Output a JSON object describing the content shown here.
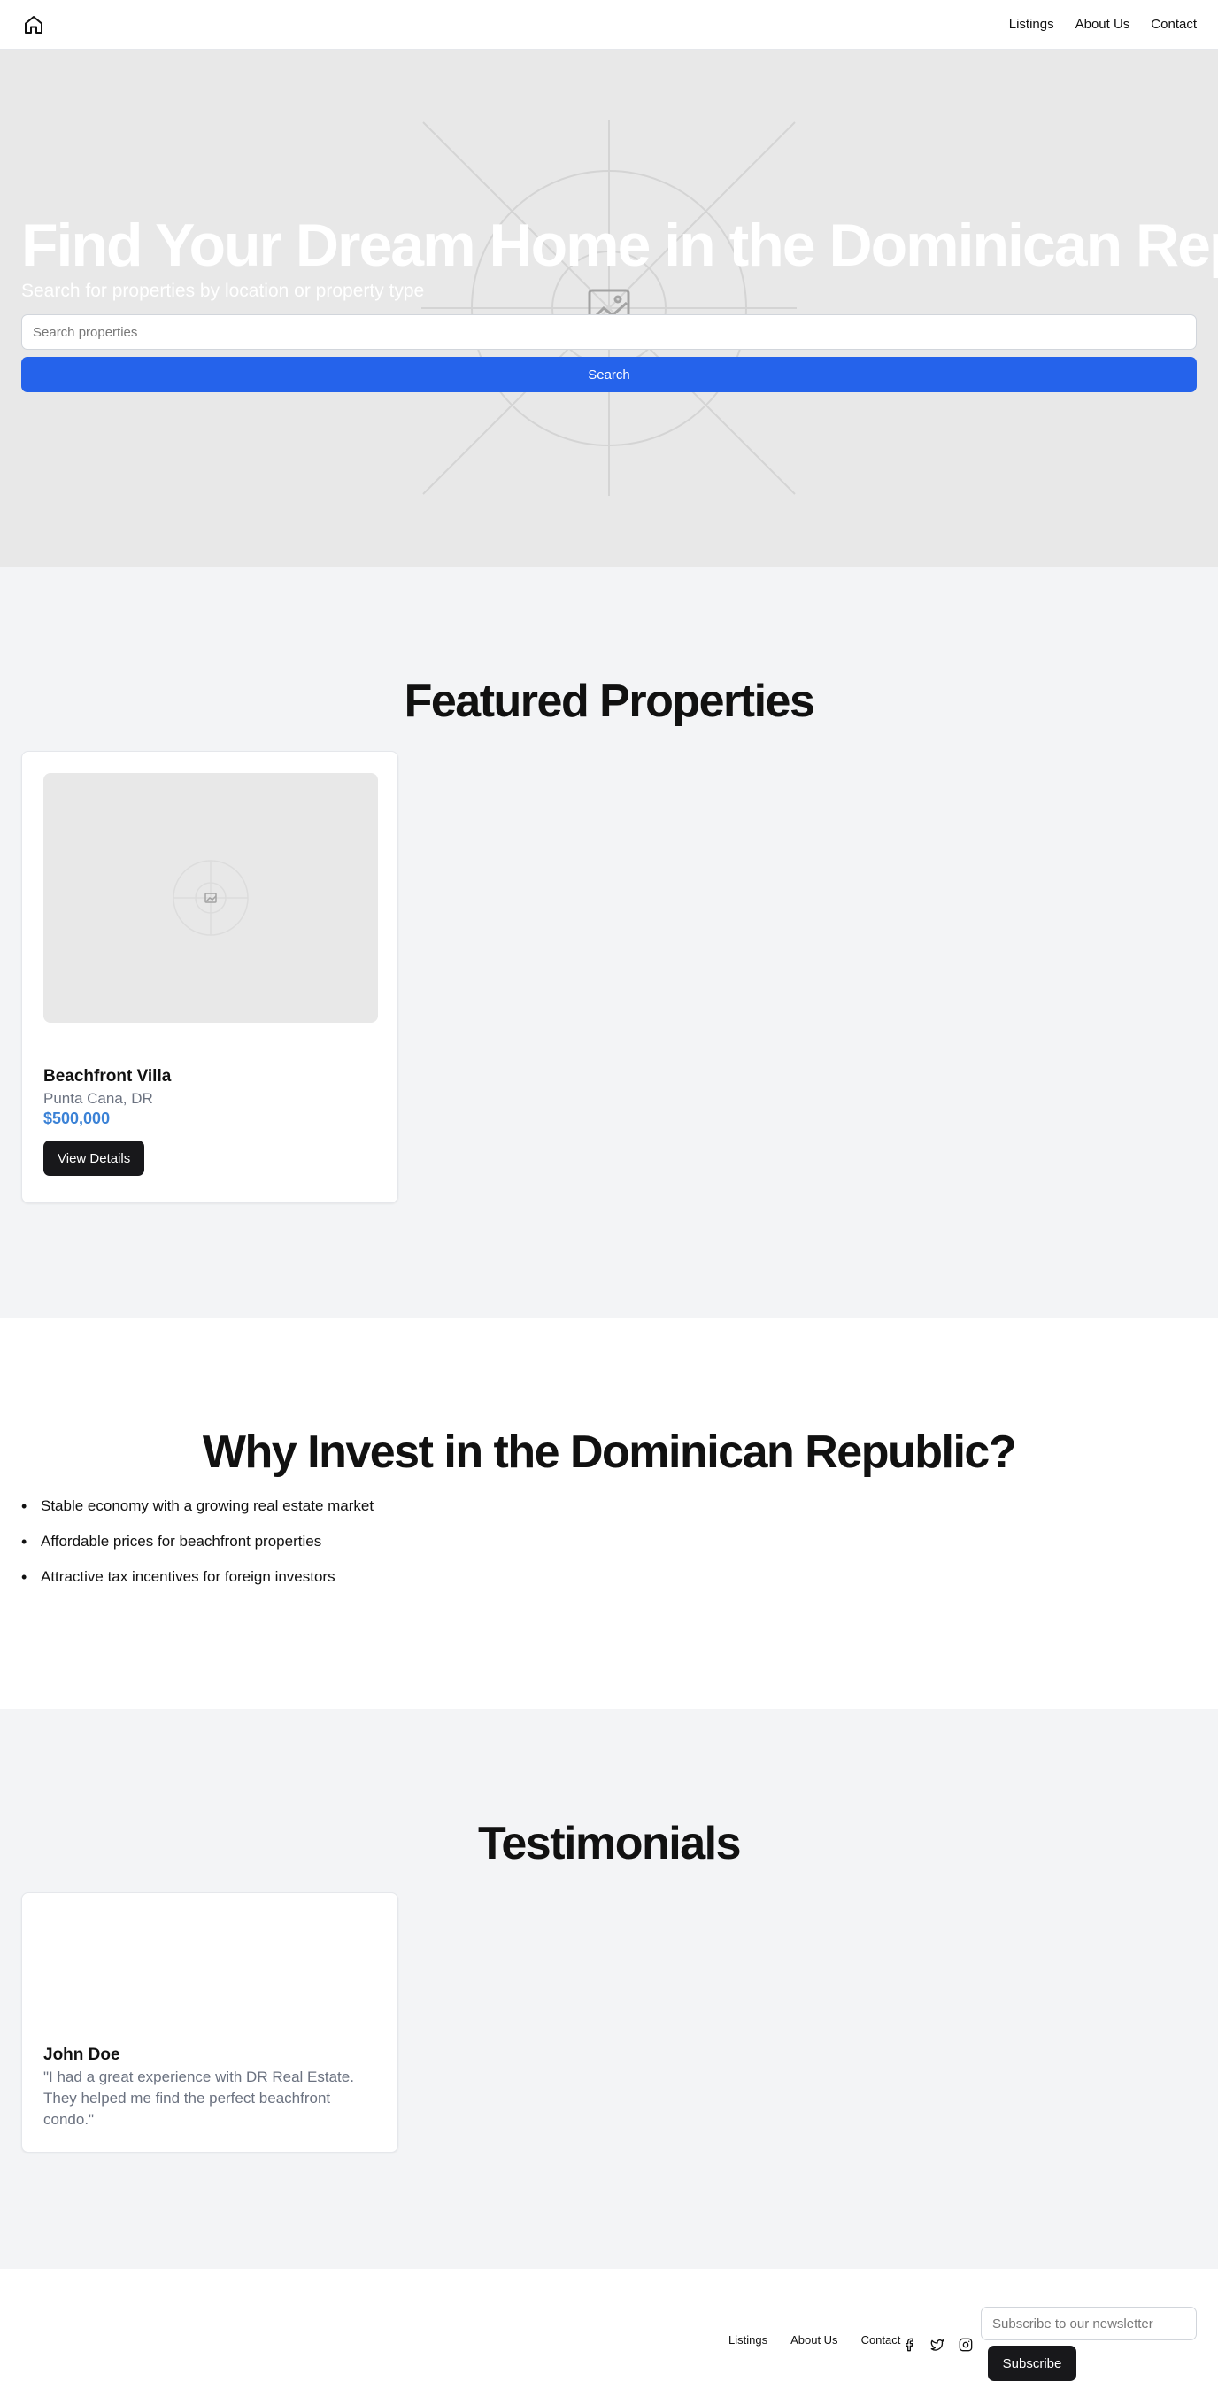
{
  "nav": {
    "logo_icon": "home-icon",
    "links": [
      "Listings",
      "About Us",
      "Contact"
    ]
  },
  "hero": {
    "title": "Find Your Dream Home in the Dominican Republic",
    "subtitle": "Search for properties by location or property type",
    "search_placeholder": "Search properties",
    "search_button": "Search",
    "image_icon": "image-placeholder-icon"
  },
  "featured": {
    "title": "Featured Properties",
    "properties": [
      {
        "name": "Beachfront Villa",
        "location": "Punta Cana, DR",
        "price": "$500,000",
        "button": "View Details",
        "image_icon": "image-placeholder-icon"
      }
    ]
  },
  "why": {
    "title": "Why Invest in the Dominican Republic?",
    "items": [
      "Stable economy with a growing real estate market",
      "Affordable prices for beachfront properties",
      "Attractive tax incentives for foreign investors"
    ]
  },
  "testimonials": {
    "title": "Testimonials",
    "items": [
      {
        "name": "John Doe",
        "quote": "\"I had a great experience with DR Real Estate. They helped me find the perfect beachfront condo.\""
      }
    ]
  },
  "footer": {
    "links": [
      "Listings",
      "About Us",
      "Contact"
    ],
    "socials": [
      "facebook-icon",
      "twitter-icon",
      "instagram-icon"
    ],
    "newsletter_placeholder": "Subscribe to our newsletter",
    "subscribe_button": "Subscribe"
  },
  "colors": {
    "primary": "#2563eb",
    "price": "#3b82d6",
    "dark_button": "#18181b",
    "section_gray": "#f3f4f6",
    "placeholder_gray": "#e8e8e8"
  }
}
